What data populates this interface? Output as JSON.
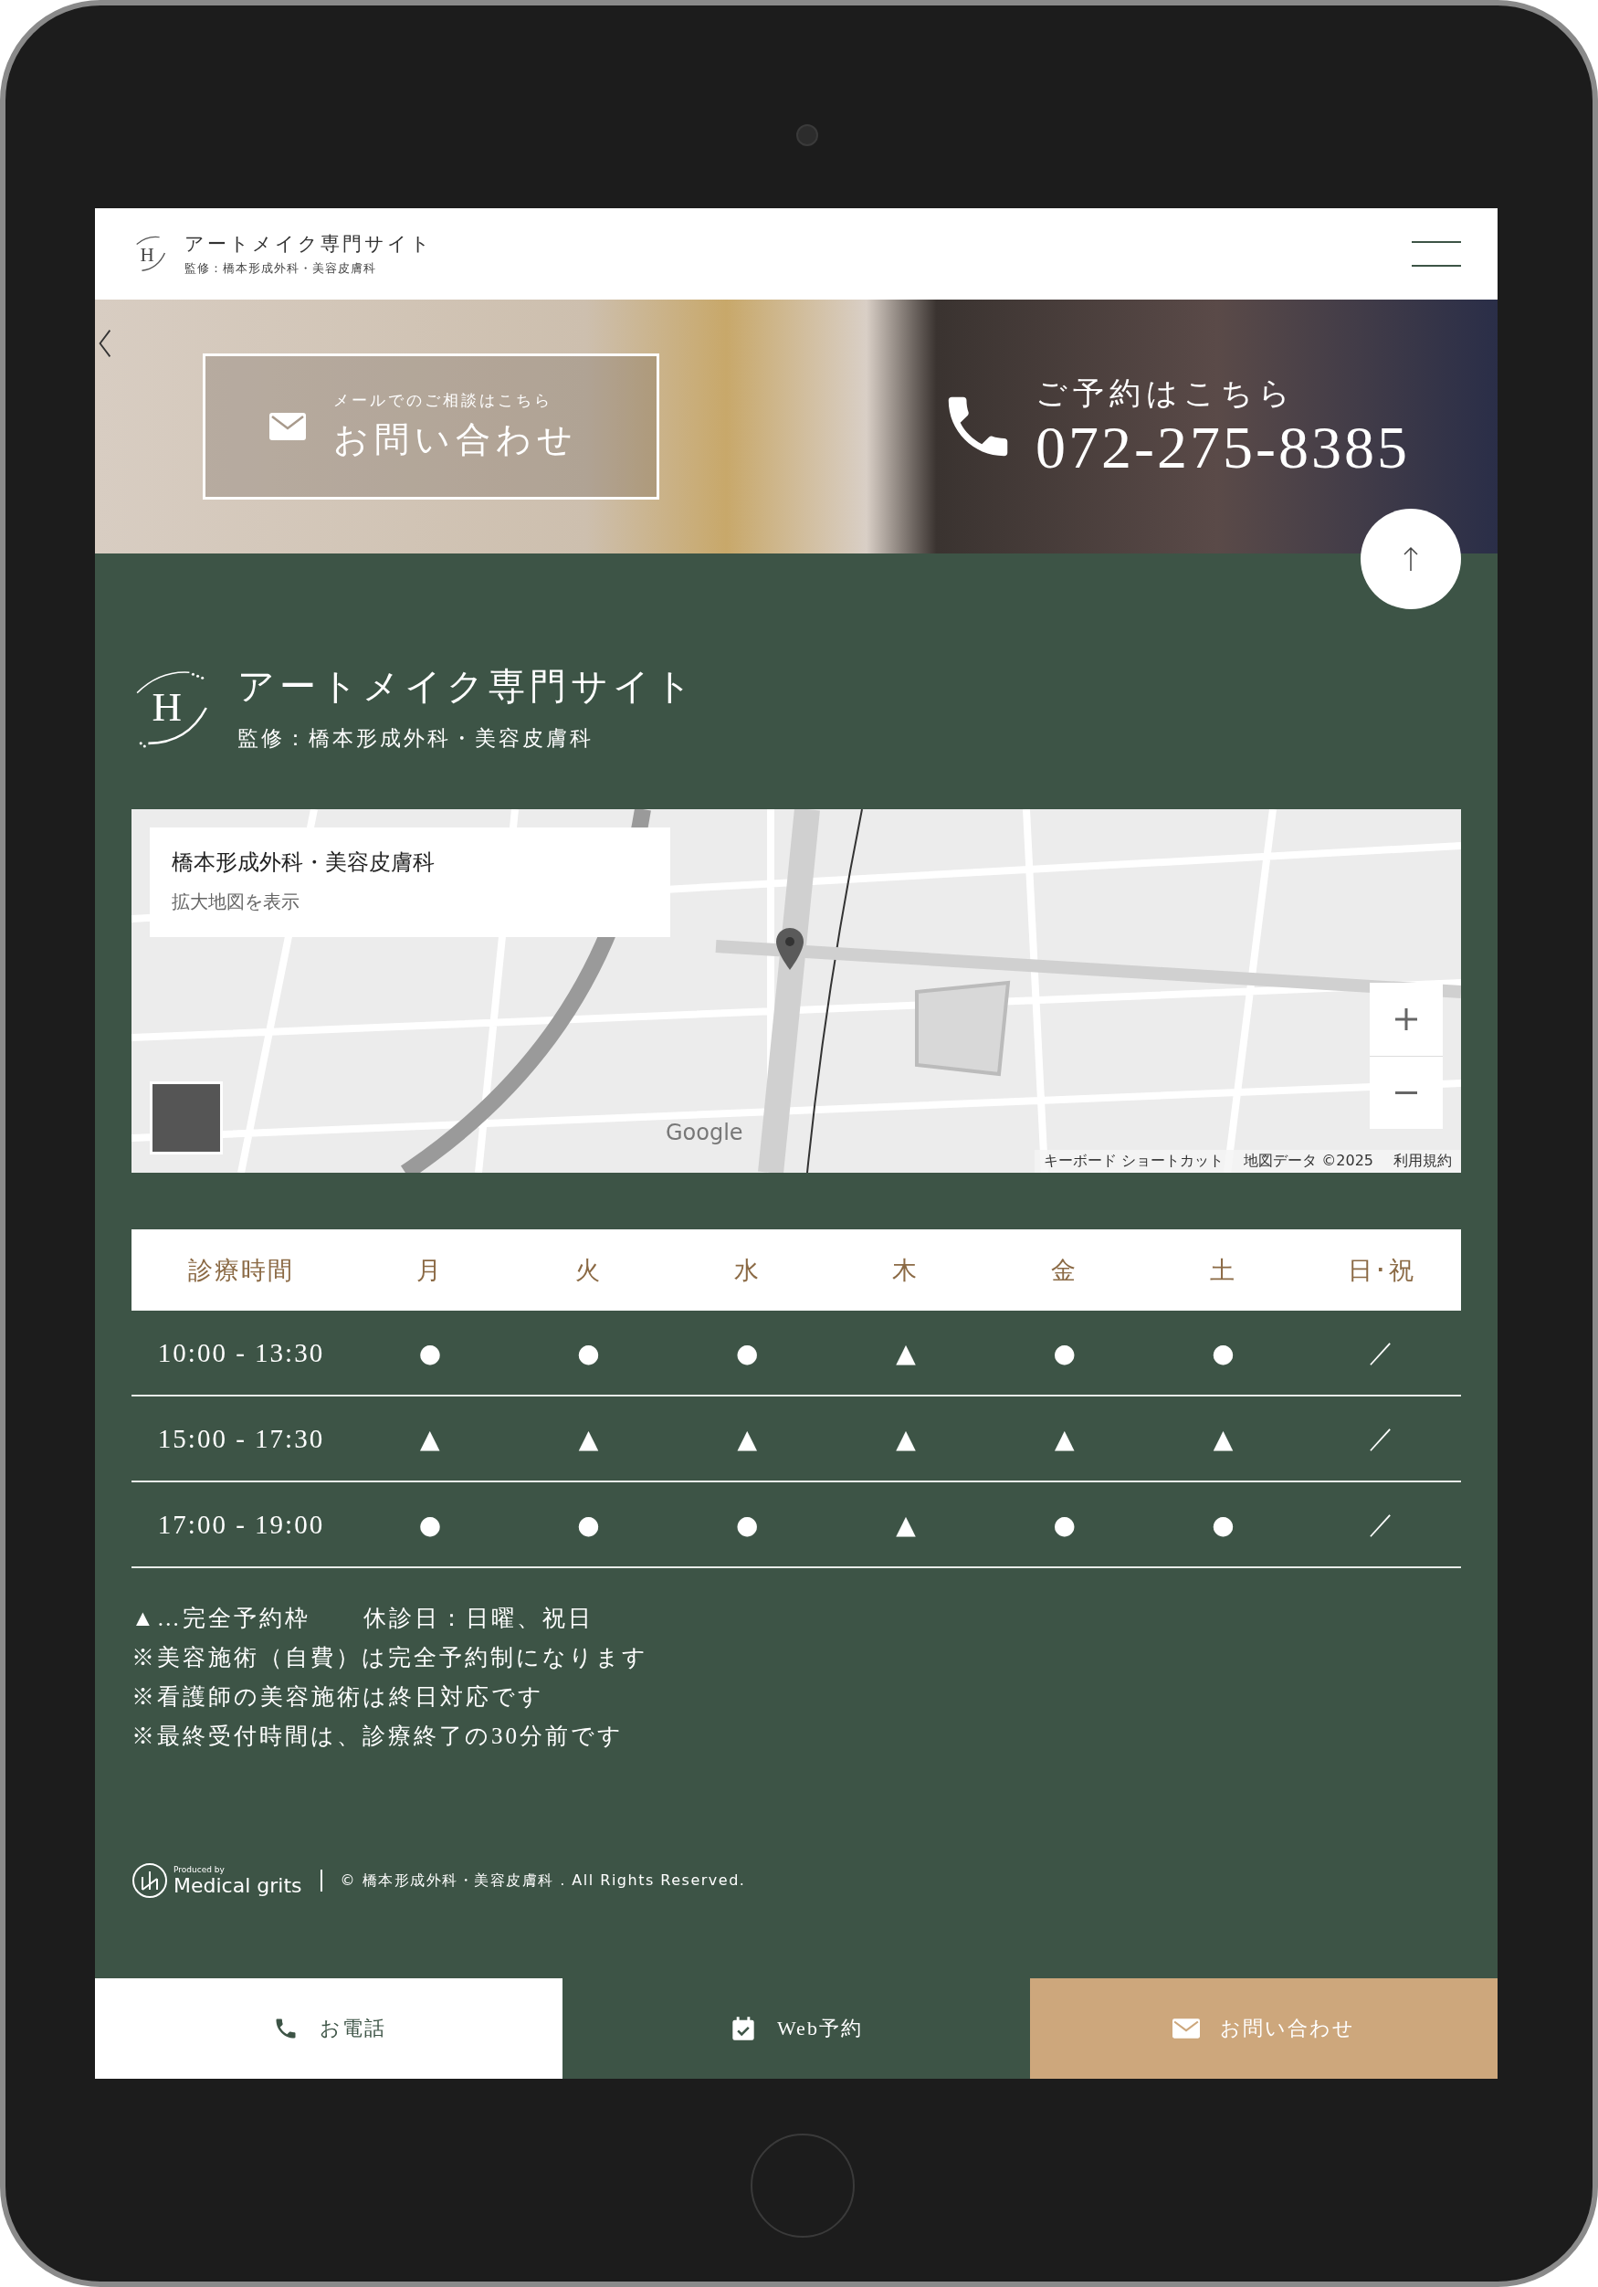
{
  "header": {
    "logo_mark": "H",
    "logo_title": "アートメイク専門サイト",
    "logo_subtitle": "監修：橋本形成外科・美容皮膚科"
  },
  "banner": {
    "mail_caption": "メールでのご相談はこちら",
    "mail_label": "お問い合わせ",
    "phone_caption": "ご予約はこちら",
    "phone_number": "072-275-8385"
  },
  "footer_logo": {
    "logo_mark": "H",
    "title": "アートメイク専門サイト",
    "subtitle": "監修：橋本形成外科・美容皮膚科"
  },
  "map": {
    "info_title": "橋本形成外科・美容皮膚科",
    "info_link": "拡大地図を表示",
    "brand": "Google",
    "attributions": [
      "キーボード ショートカット",
      "地図データ ©2025",
      "利用規約"
    ]
  },
  "schedule": {
    "columns": [
      "診療時間",
      "月",
      "火",
      "水",
      "木",
      "金",
      "土",
      "日･祝"
    ],
    "rows": [
      {
        "time": "10:00 - 13:30",
        "marks": [
          "●",
          "●",
          "●",
          "▲",
          "●",
          "●",
          "／"
        ]
      },
      {
        "time": "15:00 - 17:30",
        "marks": [
          "▲",
          "▲",
          "▲",
          "▲",
          "▲",
          "▲",
          "／"
        ]
      },
      {
        "time": "17:00 - 19:00",
        "marks": [
          "●",
          "●",
          "●",
          "▲",
          "●",
          "●",
          "／"
        ]
      }
    ]
  },
  "notes": {
    "legend": "▲…完全予約枠",
    "closed_days": "休診日：日曜、祝日",
    "lines": [
      "※美容施術（自費）は完全予約制になります",
      "※看護師の美容施術は終日対応です",
      "※最終受付時間は、診療終了の30分前です"
    ]
  },
  "credits": {
    "produced_by": "Produced by",
    "brand": "Medical grits",
    "copyright": "© 橋本形成外科・美容皮膚科 . All Rights Reserved."
  },
  "bottom_bar": [
    {
      "kind": "phone",
      "label": "お電話"
    },
    {
      "kind": "calendar",
      "label": "Web予約"
    },
    {
      "kind": "mail",
      "label": "お問い合わせ"
    }
  ]
}
